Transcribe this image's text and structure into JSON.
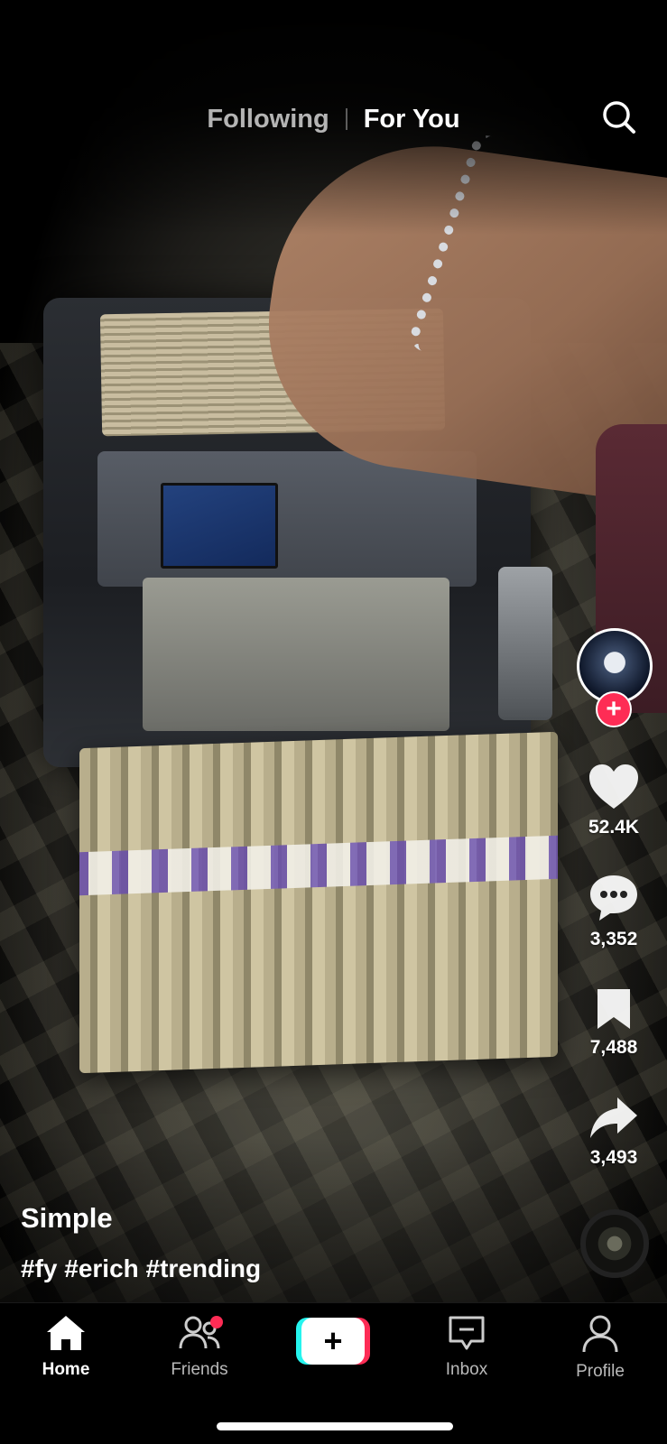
{
  "top_tabs": {
    "following": "Following",
    "for_you": "For You"
  },
  "actions": {
    "likes": "52.4K",
    "comments": "3,352",
    "saves": "7,488",
    "shares": "3,493"
  },
  "caption": {
    "username": "Simple",
    "hashtags": "#fy #erich #trending"
  },
  "bottom_nav": {
    "home": "Home",
    "friends": "Friends",
    "inbox": "Inbox",
    "profile": "Profile"
  },
  "colors": {
    "accent_red": "#fe2c55",
    "accent_cyan": "#25f4ee"
  },
  "icons": [
    "search-icon",
    "heart-icon",
    "comment-icon",
    "bookmark-icon",
    "share-icon",
    "home-icon",
    "friends-icon",
    "plus-icon",
    "inbox-icon",
    "profile-icon"
  ]
}
